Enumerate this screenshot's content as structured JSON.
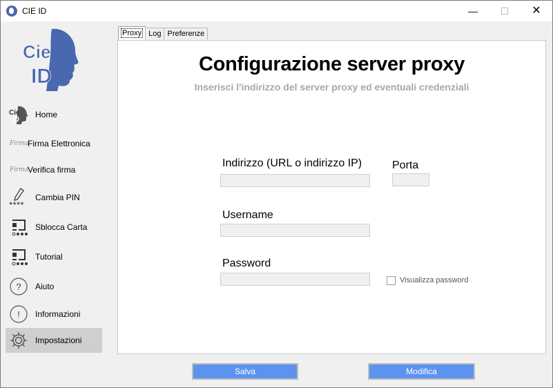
{
  "window": {
    "title": "CIE ID",
    "minimize": "—",
    "maximize": "☐",
    "close": "✕"
  },
  "logo": {
    "line1": "Cie",
    "line2": "ID",
    "brand_color": "#4a68b0"
  },
  "sidebar": {
    "items": [
      {
        "label": "Home",
        "icon": "cie-id-icon"
      },
      {
        "label": "Firma Elettronica",
        "icon": "signature-icon"
      },
      {
        "label": "Verifica firma",
        "icon": "signature-icon"
      },
      {
        "label": "Cambia PIN",
        "icon": "pencil-pin-icon"
      },
      {
        "label": "Sblocca Carta",
        "icon": "card-unlock-icon"
      },
      {
        "label": "Tutorial",
        "icon": "tutorial-icon"
      },
      {
        "label": "Aiuto",
        "icon": "question-circle-icon"
      },
      {
        "label": "Informazioni",
        "icon": "info-circle-icon"
      },
      {
        "label": "Impostazioni",
        "icon": "gear-icon",
        "active": true
      }
    ],
    "signature_glyph": "Firma"
  },
  "tabs": [
    {
      "label": "Proxy",
      "active": true
    },
    {
      "label": "Log"
    },
    {
      "label": "Preferenze"
    }
  ],
  "panel": {
    "title": "Configurazione server proxy",
    "subtitle": "Inserisci l'indirizzo del server proxy ed eventuali credenziali"
  },
  "form": {
    "address_label": "Indirizzo (URL o indirizzo IP)",
    "address_value": "",
    "port_label": "Porta",
    "port_value": "",
    "username_label": "Username",
    "username_value": "",
    "password_label": "Password",
    "password_value": "",
    "show_password_label": "Visualizza password",
    "show_password_checked": false
  },
  "buttons": {
    "save": "Salva",
    "edit": "Modifica",
    "accent": "#5c93ef"
  }
}
